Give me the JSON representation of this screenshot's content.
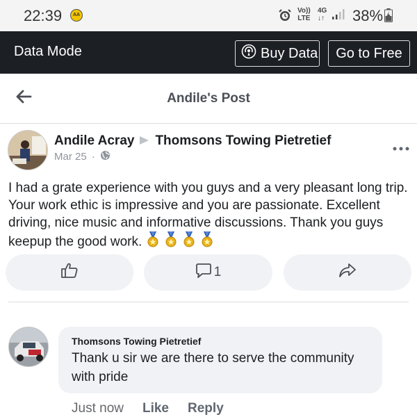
{
  "status_bar": {
    "time": "22:39",
    "badge": "AA",
    "volte_top": "Vo))",
    "volte_bottom": "LTE",
    "network_top": "4G",
    "network_bottom": "↓↑",
    "battery": "38%",
    "icons": [
      "alarm-icon",
      "signal-icon",
      "battery-charging-icon"
    ]
  },
  "mode_bar": {
    "title": "Data Mode",
    "buy_label": "Buy Data",
    "free_label": "Go to Free"
  },
  "header": {
    "title": "Andile's Post",
    "back_icon": "back-arrow-icon"
  },
  "post": {
    "author": "Andile Acray",
    "target": "Thomsons Towing Pietretief",
    "date": "Mar 25",
    "separator": "·",
    "privacy_icon": "globe-icon",
    "text": "I had a grate experience with you guys and a very pleasant long trip. Your work ethic is impressive and you are passionate. Excellent driving, nice music and informative discussions. Thank you guys keepup the good work.",
    "medal_count": 4,
    "comment_count": "1"
  },
  "comment": {
    "author": "Thomsons Towing Pietretief",
    "text": "Thank u sir we are there to serve the community with pride",
    "time": "Just now",
    "like_label": "Like",
    "reply_label": "Reply"
  },
  "colors": {
    "mode_bar_bg": "#1c1f24",
    "button_bg": "#f0f2f5",
    "medal_gold": "#e8b21a",
    "medal_ribbon": "#2f5fb5"
  }
}
